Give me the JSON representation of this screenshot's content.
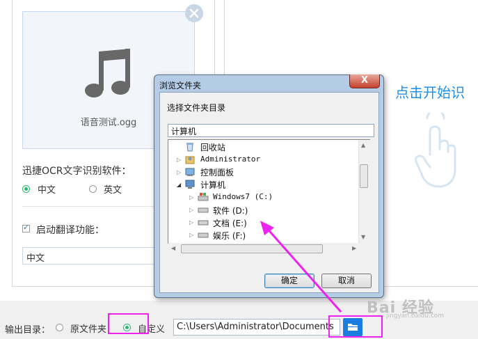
{
  "left_panel": {
    "file_name": "语音测试.ogg",
    "ocr_label": "迅捷OCR文字识别软件：",
    "ocr_options": [
      {
        "label": "中文",
        "selected": true
      },
      {
        "label": "英文",
        "selected": false
      }
    ],
    "translate_label": "启动翻译功能：",
    "translate_checked": true,
    "translate_language": "中文"
  },
  "right_panel": {
    "start_text": "点击开始识"
  },
  "bottom_bar": {
    "output_label": "输出目录：",
    "options": [
      {
        "label": "原文件夹",
        "selected": false
      },
      {
        "label": "自定义",
        "selected": true
      }
    ],
    "path": "C:\\Users\\Administrator\\Documents"
  },
  "dialog": {
    "title": "浏览文件夹",
    "close_glyph": "X",
    "subtitle": "选择文件夹目录",
    "selected_path": "计算机",
    "tree": [
      {
        "label": "回收站"
      },
      {
        "label": "Administrator"
      },
      {
        "label": "控制面板"
      },
      {
        "label": "计算机"
      },
      {
        "label": "Windows7 (C:)"
      },
      {
        "label": "软件 (D:)"
      },
      {
        "label": "文档 (E:)"
      },
      {
        "label": "娱乐 (F:)"
      }
    ],
    "ok_label": "确定",
    "cancel_label": "取消"
  },
  "watermark": {
    "text": "Bai  经验",
    "sub": "jingyan.baidu.com"
  },
  "colors": {
    "accent": "#1a7ee0",
    "radio_on": "#2bb673",
    "highlight": "#ee22ee"
  }
}
